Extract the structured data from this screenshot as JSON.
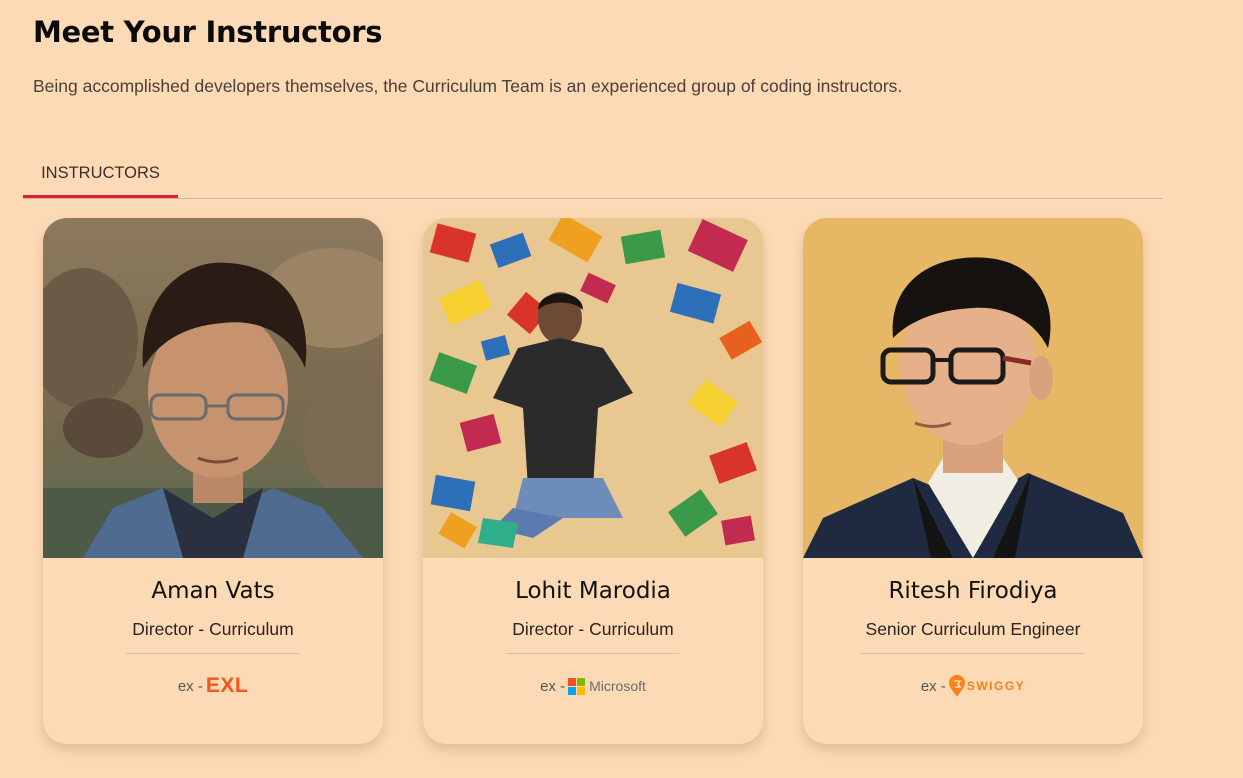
{
  "section": {
    "title": "Meet Your Instructors",
    "subtitle": "Being accomplished developers themselves, the Curriculum Team is an experienced group of coding instructors."
  },
  "tabs": [
    {
      "label": "INSTRUCTORS",
      "active": true
    }
  ],
  "colors": {
    "page_background": "#fddab6",
    "tab_underline": "#e0202f",
    "exl_orange": "#f2561d",
    "swiggy_orange": "#fc8019",
    "microsoft": [
      "#f25022",
      "#7fba00",
      "#00a4ef",
      "#ffb900"
    ]
  },
  "instructors": [
    {
      "name": "Aman Vats",
      "role": "Director - Curriculum",
      "ex_prefix": "ex -",
      "company": "EXL",
      "photo_icon": "instructor-photo"
    },
    {
      "name": "Lohit Marodia",
      "role": "Director - Curriculum",
      "ex_prefix": "ex -",
      "company": "Microsoft",
      "photo_icon": "instructor-photo"
    },
    {
      "name": "Ritesh Firodiya",
      "role": "Senior Curriculum Engineer",
      "ex_prefix": "ex -",
      "company": "SWIGGY",
      "photo_icon": "instructor-photo"
    }
  ]
}
